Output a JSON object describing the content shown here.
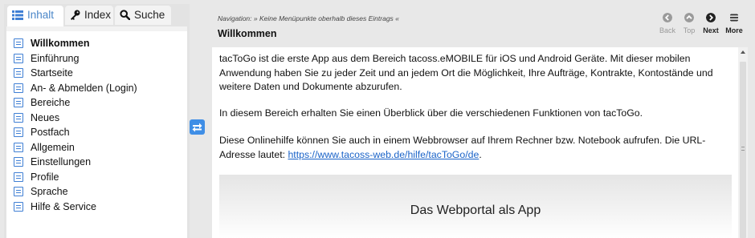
{
  "tabs": [
    {
      "label": "Inhalt",
      "icon": "list-icon",
      "active": true
    },
    {
      "label": "Index",
      "icon": "key-icon",
      "active": false
    },
    {
      "label": "Suche",
      "icon": "search-icon",
      "active": false
    }
  ],
  "toc": {
    "items": [
      {
        "label": "Willkommen",
        "selected": true
      },
      {
        "label": "Einführung"
      },
      {
        "label": "Startseite"
      },
      {
        "label": "An- & Abmelden (Login)"
      },
      {
        "label": "Bereiche"
      },
      {
        "label": "Neues"
      },
      {
        "label": "Postfach"
      },
      {
        "label": "Allgemein"
      },
      {
        "label": "Einstellungen"
      },
      {
        "label": "Profile"
      },
      {
        "label": "Sprache"
      },
      {
        "label": "Hilfe & Service"
      }
    ]
  },
  "header": {
    "navigation_label": "Navigation:",
    "navigation_text": "» Keine Menüpunkte oberhalb dieses Eintrags «",
    "title": "Willkommen",
    "buttons": {
      "back": "Back",
      "top": "Top",
      "next": "Next",
      "more": "More"
    }
  },
  "content": {
    "paragraph1": "tacToGo ist die erste App aus dem Bereich tacoss.eMOBILE für iOS und Android Geräte. Mit dieser mobilen Anwendung haben Sie zu jeder Zeit und an jedem Ort die Möglichkeit, Ihre Aufträge, Kontrakte, Kontostände und weitere Daten und Dokumente abzurufen.",
    "paragraph2": "In diesem Bereich erhalten Sie einen Überblick über die verschiedenen Funktionen von tacToGo.",
    "paragraph3_before": "Diese Onlinehilfe können Sie auch in einem Webbrowser auf Ihrem Rechner bzw. Notebook aufrufen. Die URL-Adresse lautet: ",
    "paragraph3_link": "https://www.tacoss-web.de/hilfe/tacToGo/de",
    "paragraph3_after": ".",
    "image_title": "Das Webportal als App"
  },
  "colors": {
    "accent": "#3f8ee6",
    "link": "#1a63c8",
    "icon_blue": "#3f7fd4"
  }
}
